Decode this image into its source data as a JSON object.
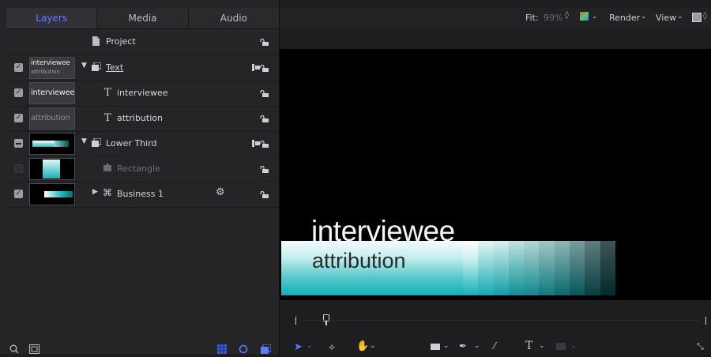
{
  "tabs": {
    "layers": "Layers",
    "media": "Media",
    "audio": "Audio"
  },
  "rows": {
    "project": {
      "label": "Project"
    },
    "text": {
      "label": "Text",
      "thumb_line1": "interviewee",
      "thumb_line2": "attribution"
    },
    "interviewee": {
      "label": "interviewee",
      "thumb": "interviewee"
    },
    "attribution": {
      "label": "attribution",
      "thumb": "attribution"
    },
    "lower_third": {
      "label": "Lower Third"
    },
    "rectangle": {
      "label": "Rectangle"
    },
    "business": {
      "label": "Business 1"
    }
  },
  "topbar": {
    "fit_label": "Fit:",
    "fit_value": "99%",
    "render": "Render",
    "view": "View"
  },
  "canvas": {
    "line1": "interviewee",
    "line2": "attribution"
  },
  "colors": {
    "accent": "#5a7cff",
    "teal": "#12b0b5"
  },
  "icons": [
    "document-icon",
    "group-icon",
    "text-icon",
    "shape-icon",
    "replicator-icon",
    "gear-icon",
    "lock-icon",
    "search-icon",
    "arrow-icon",
    "orbit-icon",
    "hand-icon",
    "pen-icon",
    "brush-icon"
  ]
}
